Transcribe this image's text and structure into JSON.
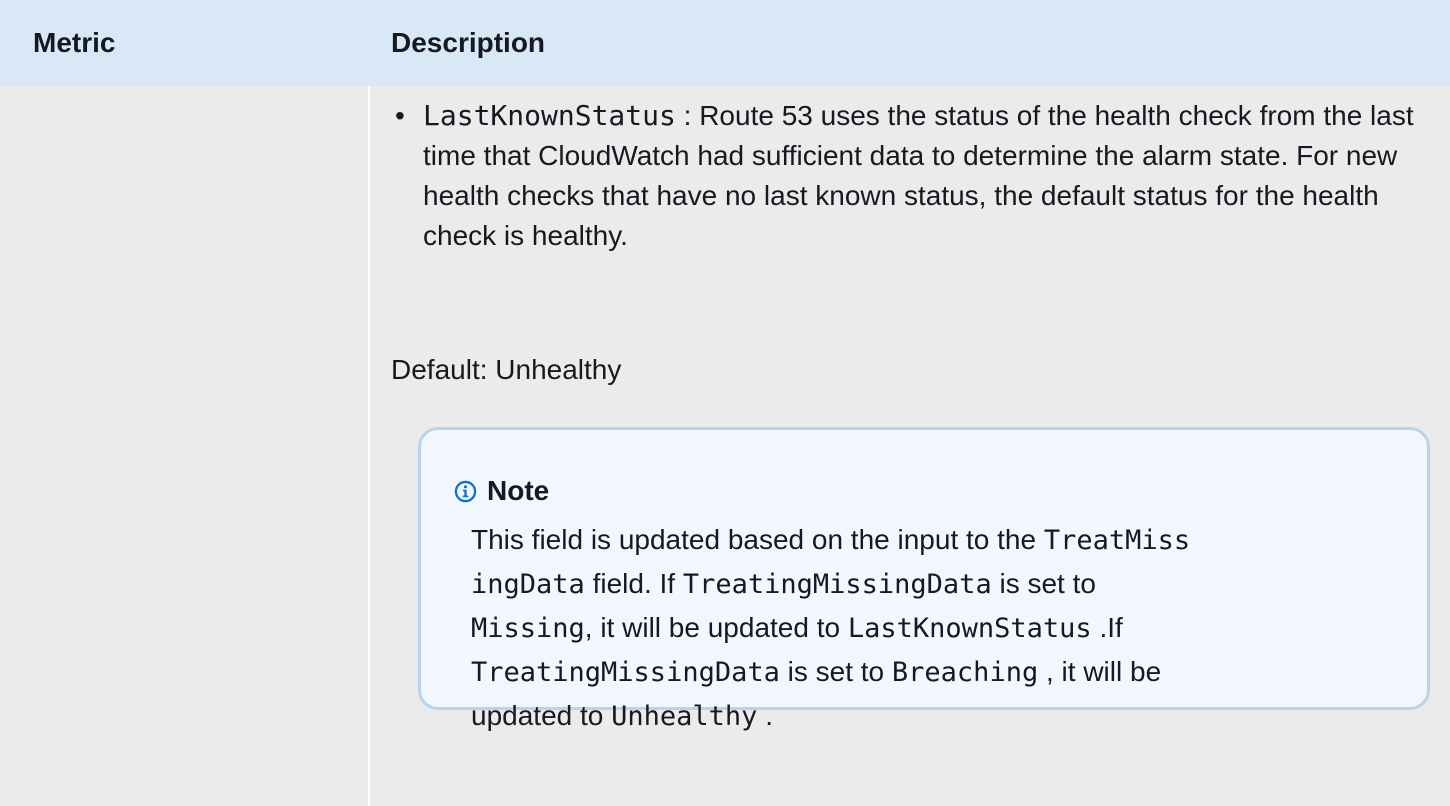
{
  "table": {
    "headers": {
      "metric": "Metric",
      "description": "Description"
    }
  },
  "description": {
    "bullet": {
      "code": "LastKnownStatus",
      "text_line1": " : Route 53 uses the status of the health check",
      "text_rest": "from the last time that CloudWatch had sufficient data to determine the alarm state. For new health checks that have no last known status, the default status for the health check is healthy."
    },
    "default_text": "Default: Unhealthy"
  },
  "note": {
    "icon": "info-icon",
    "title": "Note",
    "parts": {
      "p1": "This field is updated based on the input to the ",
      "c1a": "TreatMiss",
      "c1b": "ingData",
      "p2": " field. If ",
      "c2": "TreatingMissingData",
      "p3": " is set to",
      "c3": "Missing",
      "p4": ", it will be updated to ",
      "c4": "LastKnownStatus",
      "p5": " .If",
      "c5": "TreatingMissingData",
      "p6": " is set to ",
      "c6": "Breaching",
      "p7": " , it will be",
      "p8": "updated to ",
      "c7": "Unhealthy",
      "p9": " ."
    }
  },
  "colors": {
    "header_bg": "#d9e8f6",
    "row_bg": "#ebebec",
    "note_border": "#b7d4ee",
    "note_bg": "#f1f7fd",
    "info_icon": "#0972d3"
  }
}
